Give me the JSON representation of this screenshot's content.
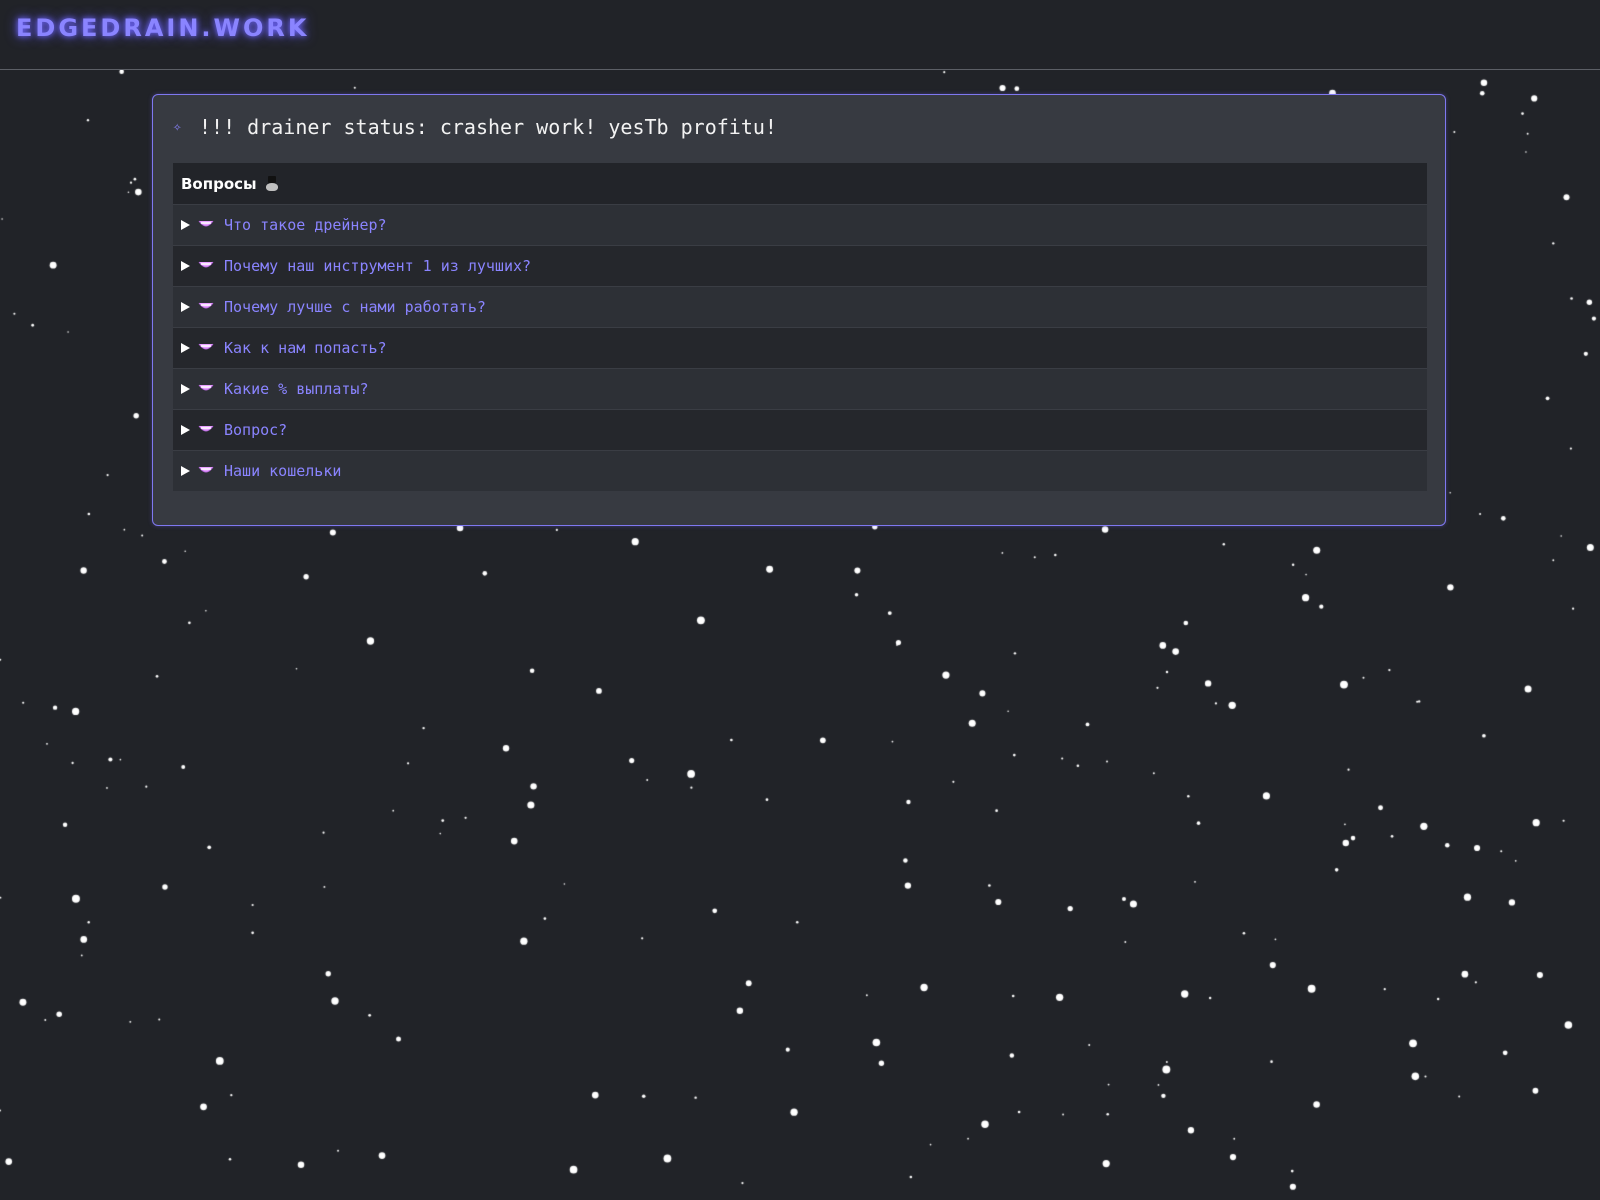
{
  "header": {
    "brand": "EDGEDRAIN.WORK"
  },
  "panel": {
    "status_icon": "sparkle-arrow-icon",
    "status_text": "!!! drainer status: crasher work! yesTb profitu!"
  },
  "faq": {
    "title": "Вопросы",
    "title_icon": "hat-icon",
    "item_icon": "grin-icon",
    "items": [
      {
        "label": "Что такое дрейнер?"
      },
      {
        "label": "Почему наш инструмент 1 из лучших?"
      },
      {
        "label": "Почему лучше с нами работать?"
      },
      {
        "label": "Как к нам попасть?"
      },
      {
        "label": "Какие % выплаты?"
      },
      {
        "label": "Вопрос?"
      },
      {
        "label": "Наши кошельки"
      }
    ]
  },
  "colors": {
    "background": "#212328",
    "panel": "#373a41",
    "accent": "#8a84ff",
    "text": "#f2f2f2"
  }
}
